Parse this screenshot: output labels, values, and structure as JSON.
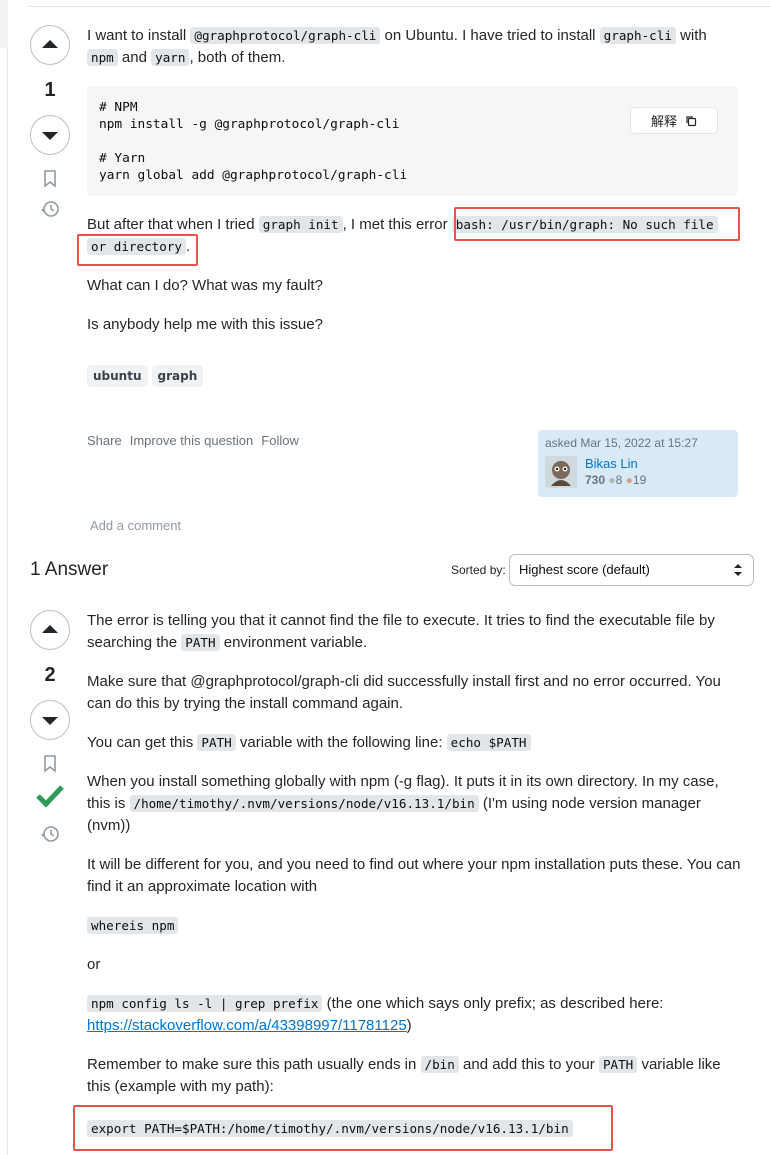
{
  "question": {
    "votes": "1",
    "intro": {
      "t1": "I want to install ",
      "c1": "@graphprotocol/graph-cli",
      "t2": " on Ubuntu. I have tried to install ",
      "c2": "graph-cli",
      "t3": " with",
      "c3": "npm",
      "t4": " and ",
      "c4": "yarn",
      "t5": ", both of them."
    },
    "code_lines": [
      "# NPM",
      "npm install -g @graphprotocol/graph-cli",
      "",
      "# Yarn",
      "yarn global add @graphprotocol/graph-cli"
    ],
    "copy_label": "解释",
    "error_para": {
      "t1": "But after that when I tried ",
      "c1": "graph init",
      "t2": ", I met this error ",
      "c2a": "bash: /usr/bin/graph: No such file",
      "c2b": "or directory",
      "t3": "."
    },
    "p2": "What can I do? What was my fault?",
    "p3": "Is anybody help me with this issue?",
    "tags": [
      "ubuntu",
      "graph"
    ],
    "actions": [
      "Share",
      "Improve this question",
      "Follow"
    ],
    "owner": {
      "asked": "asked Mar 15, 2022 at 15:27",
      "name": "Bikas Lin",
      "rep": "730",
      "silver": "8",
      "bronze": "19"
    },
    "add_comment": "Add a comment"
  },
  "answers_header": {
    "count_label": "1 Answer",
    "sorted_by": "Sorted by:",
    "sort_value": "Highest score (default)"
  },
  "answer": {
    "votes": "2",
    "p1": {
      "t1": "The error is telling you that it cannot find the file to execute. It tries to find the executable file by searching the ",
      "c1": "PATH",
      "t2": " environment variable."
    },
    "p2": "Make sure that @graphprotocol/graph-cli did successfully install first and no error occurred. You can do this by trying the install command again.",
    "p3": {
      "t1": "You can get this ",
      "c1": "PATH",
      "t2": " variable with the following line: ",
      "c2": "echo $PATH"
    },
    "p4": {
      "t1": "When you install something globally with npm (-g flag). It puts it in its own directory. In my case, this is ",
      "c1": "/home/timothy/.nvm/versions/node/v16.13.1/bin",
      "t2": " (I'm using node version manager (nvm))"
    },
    "p5": "It will be different for you, and you need to find out where your npm installation puts these. You can find it an approximate location with",
    "p6_code": "whereis npm",
    "p7": "or",
    "p8": {
      "c1": "npm config ls -l | grep prefix",
      "t1": " (the one which says only prefix; as described here: ",
      "link": "https://stackoverflow.com/a/43398997/11781125",
      "t2": ")"
    },
    "p9": {
      "t1": "Remember to make sure this path usually ends in ",
      "c1": "/bin",
      "t2": " and add this to your ",
      "c2": "PATH",
      "t3": " variable like this (example with my path):"
    },
    "p10_code": "export PATH=$PATH:/home/timothy/.nvm/versions/node/v16.13.1/bin"
  },
  "colors": {
    "accent": "#0074cc",
    "accepted": "#2f9a5c",
    "highlight": "#e5534b"
  }
}
